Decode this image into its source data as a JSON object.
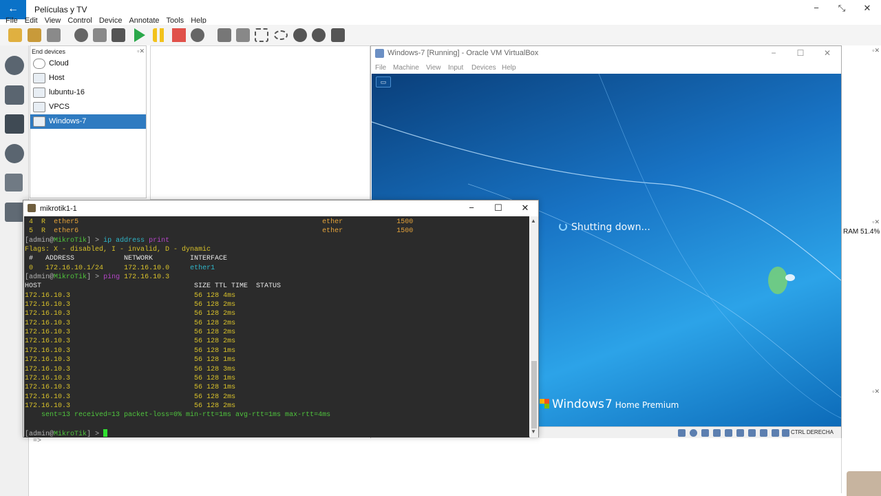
{
  "host": {
    "title": "Películas y TV",
    "back_icon": "←",
    "min": "−",
    "restore": "⤡",
    "close": "✕"
  },
  "gns3": {
    "menu": [
      "File",
      "Edit",
      "View",
      "Control",
      "Device",
      "Annotate",
      "Tools",
      "Help"
    ],
    "end_devices": {
      "title": "End devices",
      "items": [
        {
          "label": "Cloud",
          "icon": "cloud-icon"
        },
        {
          "label": "Host",
          "icon": "host-icon"
        },
        {
          "label": "lubuntu-16",
          "icon": "vm-icon"
        },
        {
          "label": "VPCS",
          "icon": "vpcs-icon"
        },
        {
          "label": "Windows-7",
          "icon": "vm-icon",
          "selected": true
        }
      ]
    },
    "ram_label": "RAM 51.4%",
    "console_prompt": "=>"
  },
  "vbox": {
    "title": "Windows-7 [Running] - Oracle VM VirtualBox",
    "menu": [
      "File",
      "Machine",
      "View",
      "Input",
      "Devices",
      "Help"
    ],
    "shutdown_text": "Shutting down...",
    "brand_windows": "Windows",
    "brand_version": "7",
    "brand_edition": "Home Premium",
    "host_key": "CTRL DERECHA"
  },
  "terminal": {
    "title": "mikrotik1-1",
    "if_rows": [
      {
        "num": "4",
        "flag": "R",
        "name": "ether5",
        "type": "ether",
        "mtu": "1500"
      },
      {
        "num": "5",
        "flag": "R",
        "name": "ether6",
        "type": "ether",
        "mtu": "1500"
      }
    ],
    "prompt_user": "admin",
    "prompt_host": "MikroTik",
    "cmd1_a": "ip address",
    "cmd1_b": "print",
    "flags_line": "Flags: X - disabled, I - invalid, D - dynamic",
    "addr_header": " #   ADDRESS            NETWORK         INTERFACE",
    "addr_row": {
      "num": "0",
      "address": "172.16.10.1/24",
      "network": "172.16.10.0",
      "interface": "ether1"
    },
    "cmd2_a": "ping",
    "cmd2_b": "172.16.10.3",
    "ping_header": "HOST                                     SIZE TTL TIME  STATUS",
    "ping_rows": [
      {
        "host": "172.16.10.3",
        "size": "56",
        "ttl": "128",
        "time": "4ms"
      },
      {
        "host": "172.16.10.3",
        "size": "56",
        "ttl": "128",
        "time": "2ms"
      },
      {
        "host": "172.16.10.3",
        "size": "56",
        "ttl": "128",
        "time": "2ms"
      },
      {
        "host": "172.16.10.3",
        "size": "56",
        "ttl": "128",
        "time": "2ms"
      },
      {
        "host": "172.16.10.3",
        "size": "56",
        "ttl": "128",
        "time": "2ms"
      },
      {
        "host": "172.16.10.3",
        "size": "56",
        "ttl": "128",
        "time": "2ms"
      },
      {
        "host": "172.16.10.3",
        "size": "56",
        "ttl": "128",
        "time": "1ms"
      },
      {
        "host": "172.16.10.3",
        "size": "56",
        "ttl": "128",
        "time": "1ms"
      },
      {
        "host": "172.16.10.3",
        "size": "56",
        "ttl": "128",
        "time": "3ms"
      },
      {
        "host": "172.16.10.3",
        "size": "56",
        "ttl": "128",
        "time": "1ms"
      },
      {
        "host": "172.16.10.3",
        "size": "56",
        "ttl": "128",
        "time": "1ms"
      },
      {
        "host": "172.16.10.3",
        "size": "56",
        "ttl": "128",
        "time": "2ms"
      },
      {
        "host": "172.16.10.3",
        "size": "56",
        "ttl": "128",
        "time": "2ms"
      }
    ],
    "summary": "    sent=13 received=13 packet-loss=0% min-rtt=1ms avg-rtt=1ms max-rtt=4ms"
  }
}
